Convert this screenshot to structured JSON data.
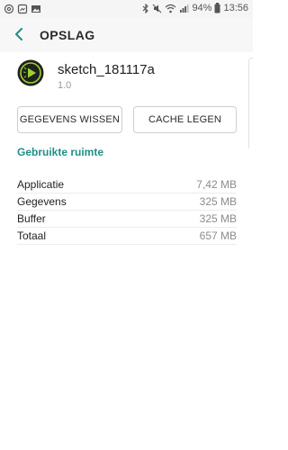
{
  "status_bar": {
    "battery": "94%",
    "time": "13:56",
    "icons_left": [
      "at-sign-icon",
      "notification-icon",
      "image-icon"
    ],
    "icons_right": [
      "bluetooth-icon",
      "mute-icon",
      "wifi-icon",
      "signal-icon",
      "battery-icon"
    ]
  },
  "header": {
    "title": "OPSLAG",
    "back_icon": "back-arrow-icon"
  },
  "app": {
    "name": "sketch_181117a",
    "version": "1.0",
    "icon": "processing-app-icon"
  },
  "buttons": {
    "clear_data": "GEGEVENS WISSEN",
    "clear_cache": "CACHE LEGEN"
  },
  "storage": {
    "section_title": "Gebruikte ruimte",
    "rows": [
      {
        "label": "Applicatie",
        "value": "7,42 MB"
      },
      {
        "label": "Gegevens",
        "value": "325 MB"
      },
      {
        "label": "Buffer",
        "value": "325 MB"
      },
      {
        "label": "Totaal",
        "value": "657 MB"
      }
    ]
  },
  "colors": {
    "accent": "#1e8f87",
    "app_icon_bg": "#202020",
    "app_icon_ring": "#9bd22f"
  }
}
